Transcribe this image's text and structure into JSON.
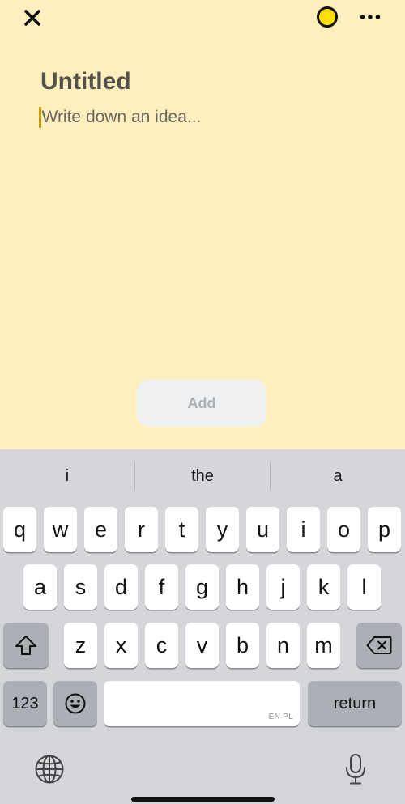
{
  "header": {
    "close_icon": "close-icon",
    "color_icon": "color-picker-icon",
    "more_icon": "more-dots-icon",
    "note_color": "#FFE000"
  },
  "note": {
    "title": "Untitled",
    "body_value": "",
    "body_placeholder": "Write down an idea...",
    "background": "#FFEFBF"
  },
  "add_button": {
    "label": "Add"
  },
  "keyboard": {
    "suggestions": [
      "i",
      "the",
      "a"
    ],
    "row1": [
      "q",
      "w",
      "e",
      "r",
      "t",
      "y",
      "u",
      "i",
      "o",
      "p"
    ],
    "row2": [
      "a",
      "s",
      "d",
      "f",
      "g",
      "h",
      "j",
      "k",
      "l"
    ],
    "row3": [
      "z",
      "x",
      "c",
      "v",
      "b",
      "n",
      "m"
    ],
    "shift_icon": "shift-icon",
    "backspace_icon": "backspace-icon",
    "numbers_label": "123",
    "emoji_icon": "emoji-icon",
    "space_language": "EN PL",
    "return_label": "return",
    "globe_icon": "globe-icon",
    "mic_icon": "microphone-icon"
  }
}
